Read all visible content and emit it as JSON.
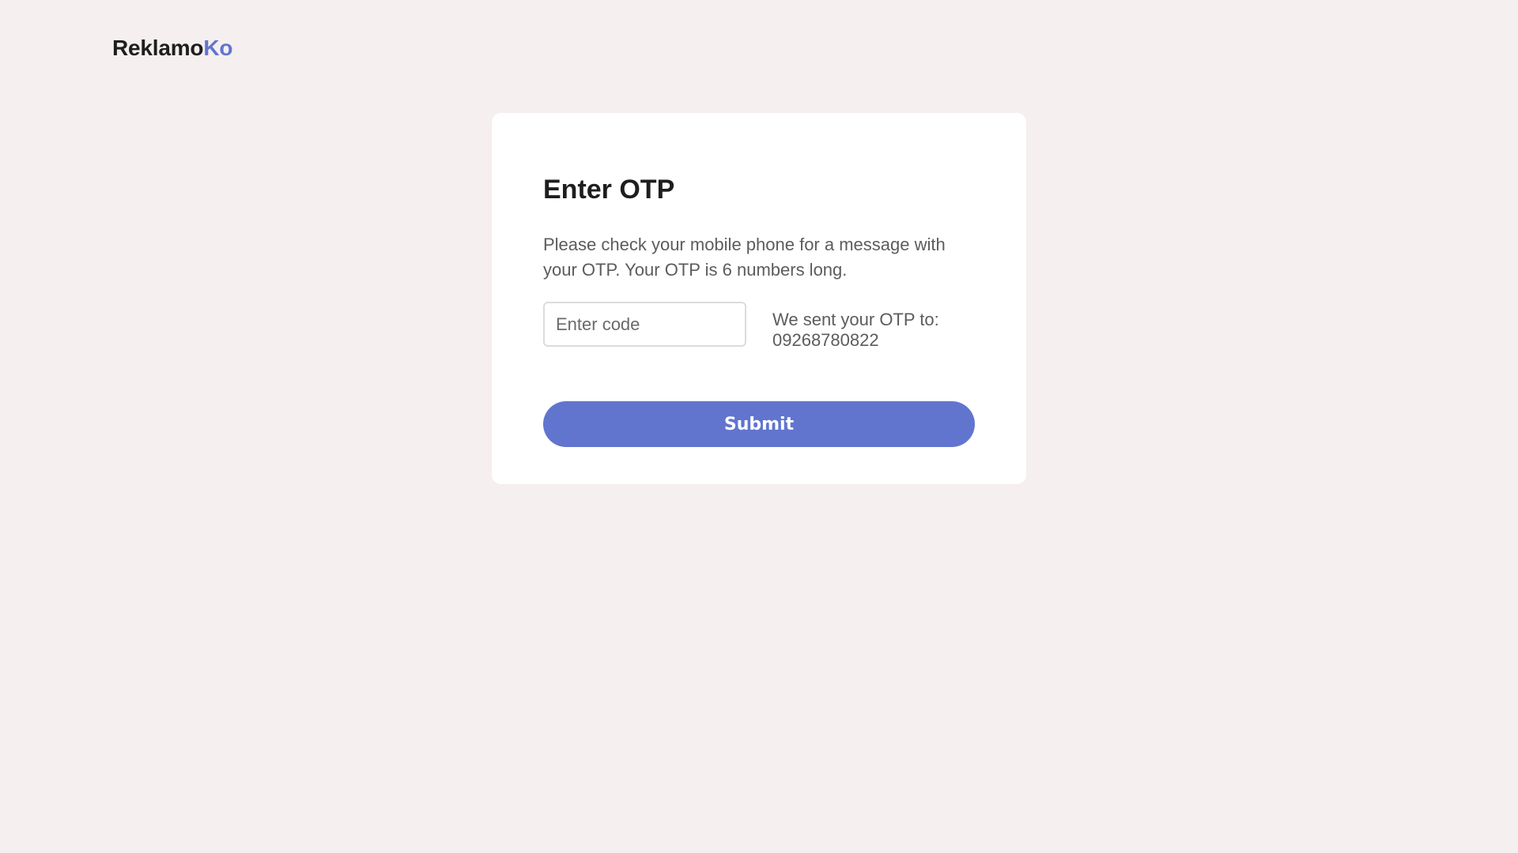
{
  "header": {
    "logo_main": "Reklamo",
    "logo_accent": "Ko"
  },
  "otp_form": {
    "title": "Enter OTP",
    "description": "Please check your mobile phone for a message with your OTP. Your OTP is 6 numbers long.",
    "code_input_placeholder": "Enter code",
    "code_input_value": "",
    "sent_label": "We sent your OTP to:",
    "phone_number": "09268780822",
    "submit_label": "Submit"
  },
  "colors": {
    "page_background": "#f5efef",
    "card_background": "#ffffff",
    "accent": "#6175cf",
    "title_text": "#1e1e1e",
    "body_text": "#5c5c5c"
  }
}
